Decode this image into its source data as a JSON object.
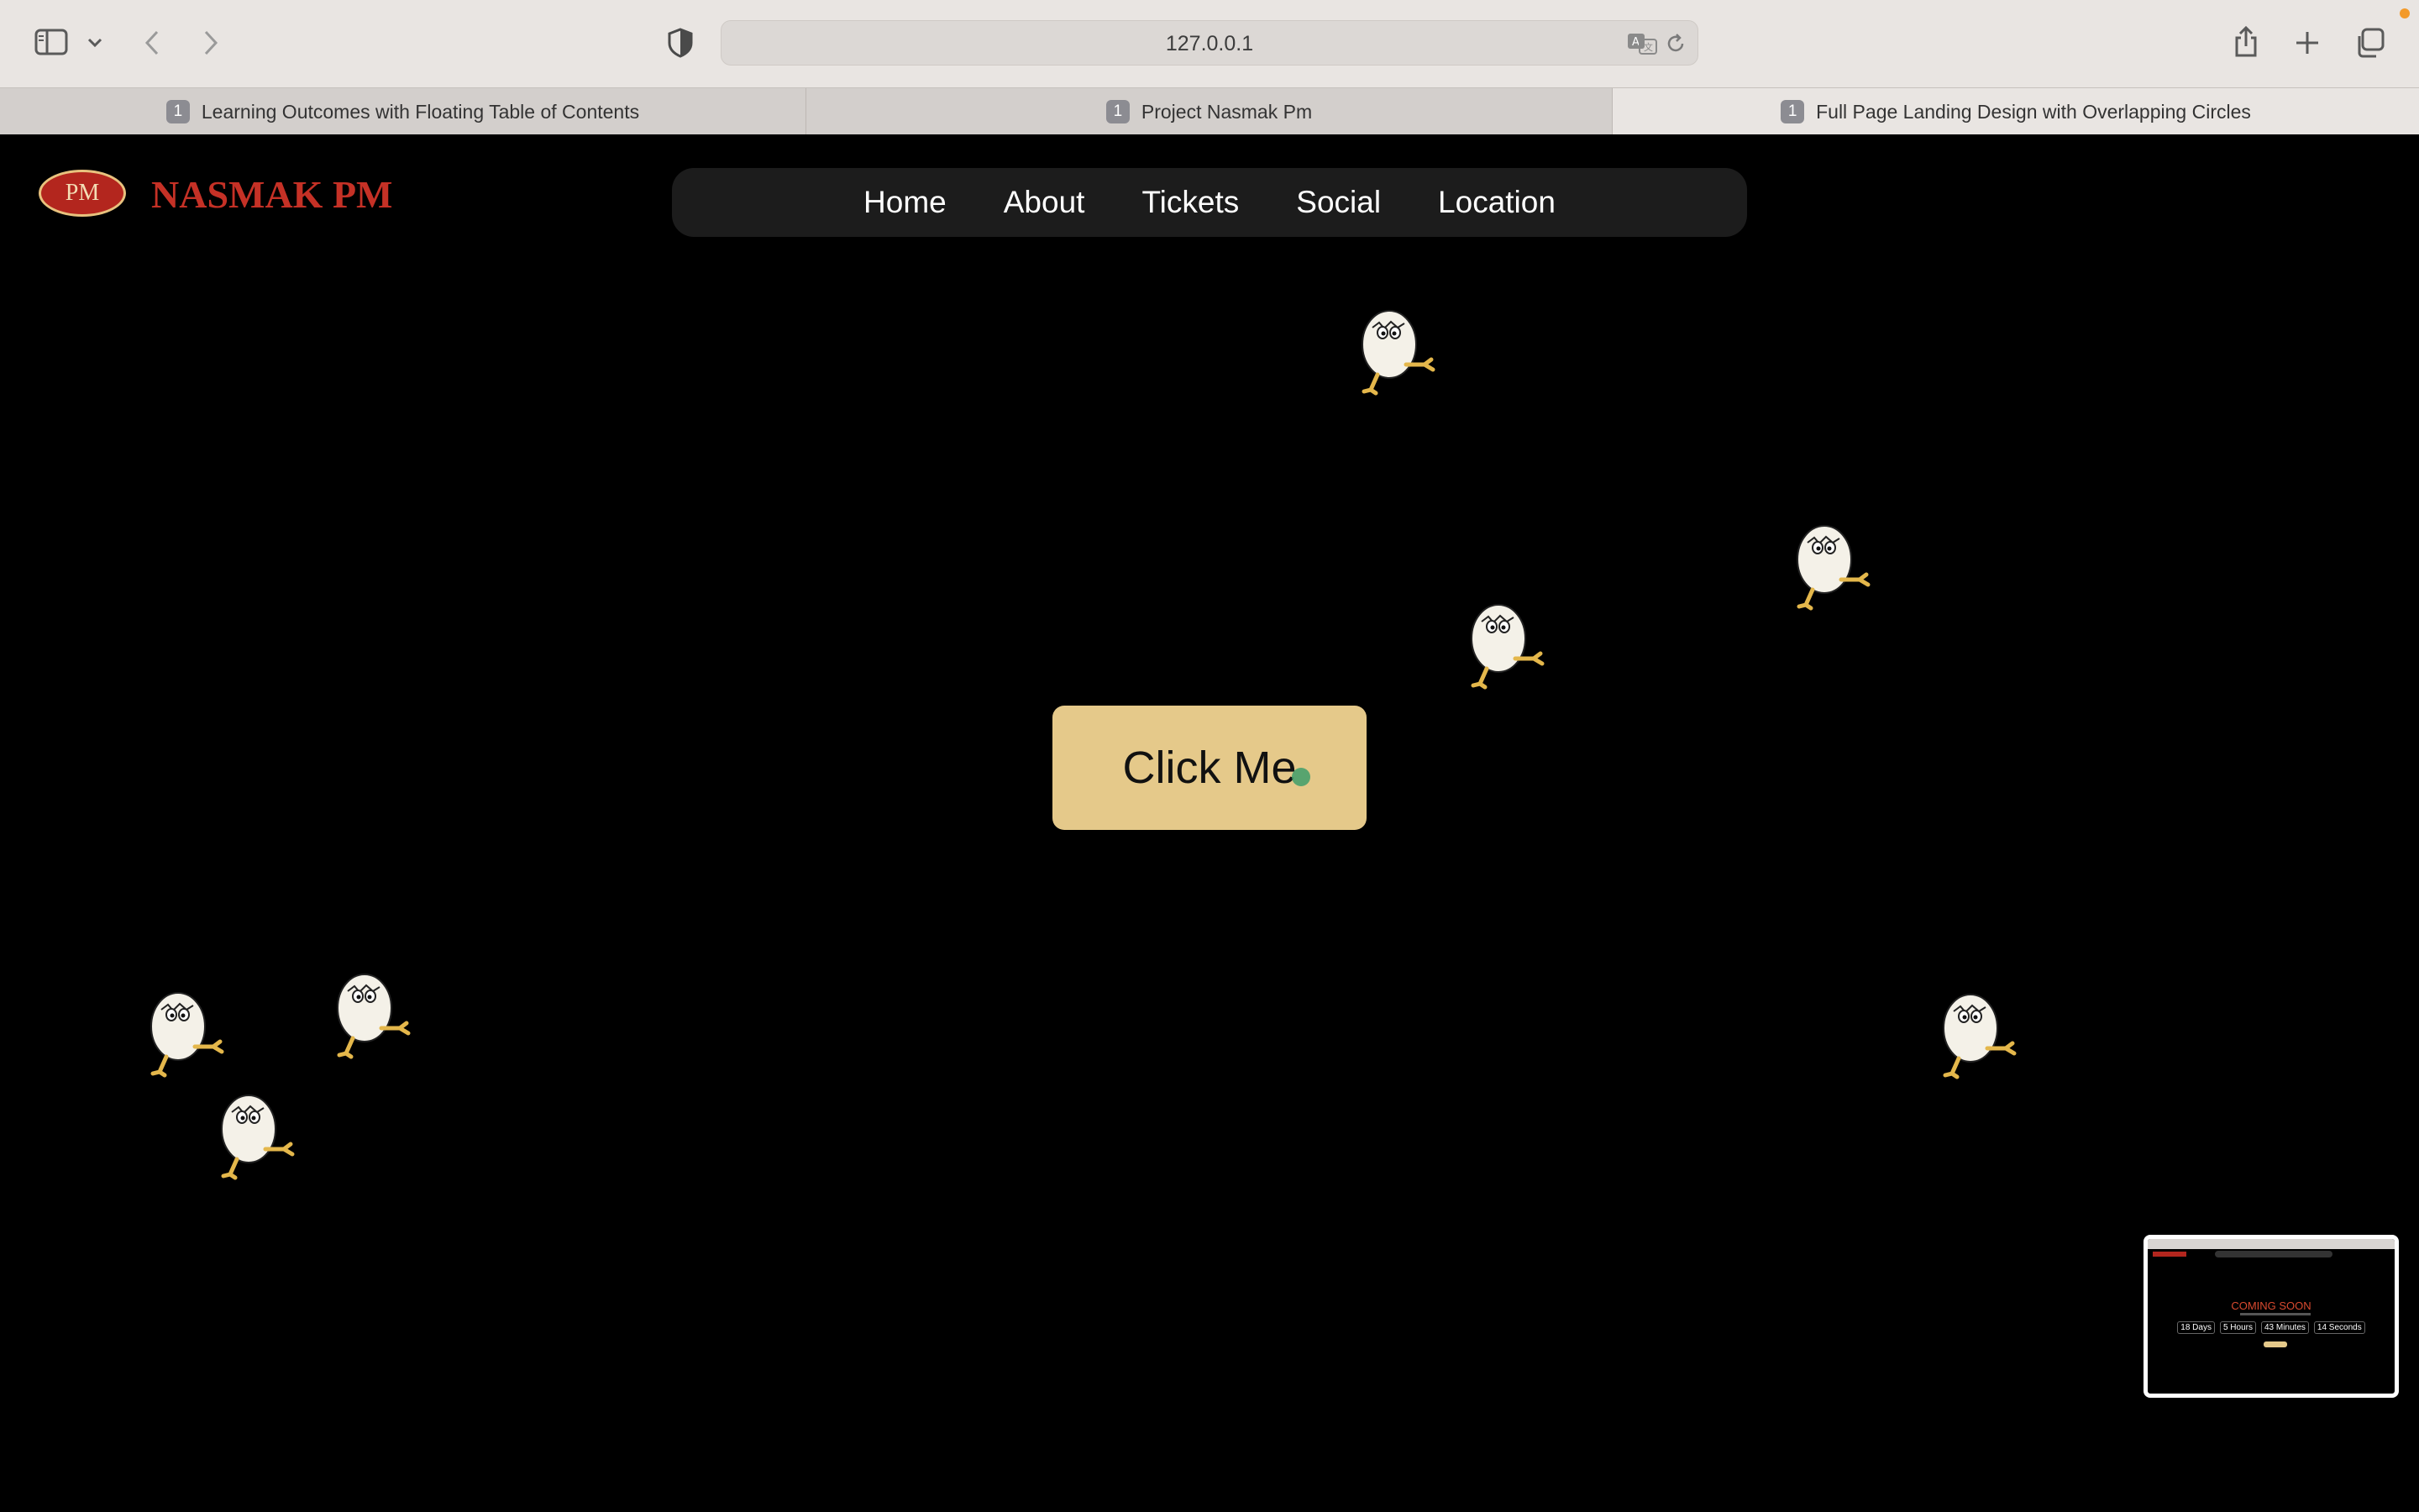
{
  "browser": {
    "url": "127.0.0.1",
    "tabs": [
      {
        "count": "1",
        "title": "Learning Outcomes with Floating Table of Contents",
        "active": false
      },
      {
        "count": "1",
        "title": "Project Nasmak Pm",
        "active": false
      },
      {
        "count": "1",
        "title": "Full Page Landing Design with Overlapping Circles",
        "active": true
      }
    ],
    "icons": [
      "sidebar-icon",
      "chevron-down-icon",
      "back-icon",
      "forward-icon",
      "privacy-shield-icon",
      "translate-icon",
      "reload-icon",
      "share-icon",
      "plus-icon",
      "tabs-overview-icon"
    ]
  },
  "site": {
    "logo_text": "PM",
    "brand": "NASMAK PM",
    "nav": [
      "Home",
      "About",
      "Tickets",
      "Social",
      "Location"
    ],
    "cta_label": "Click Me"
  },
  "thumbnail": {
    "heading": "COMING SOON",
    "counters": [
      "18 Days",
      "5 Hours",
      "43 Minutes",
      "14 Seconds"
    ]
  },
  "colors": {
    "page_bg": "#000000",
    "brand_red": "#c53126",
    "nav_bg": "#1c1c1c",
    "cta_bg": "#e5c98a"
  }
}
